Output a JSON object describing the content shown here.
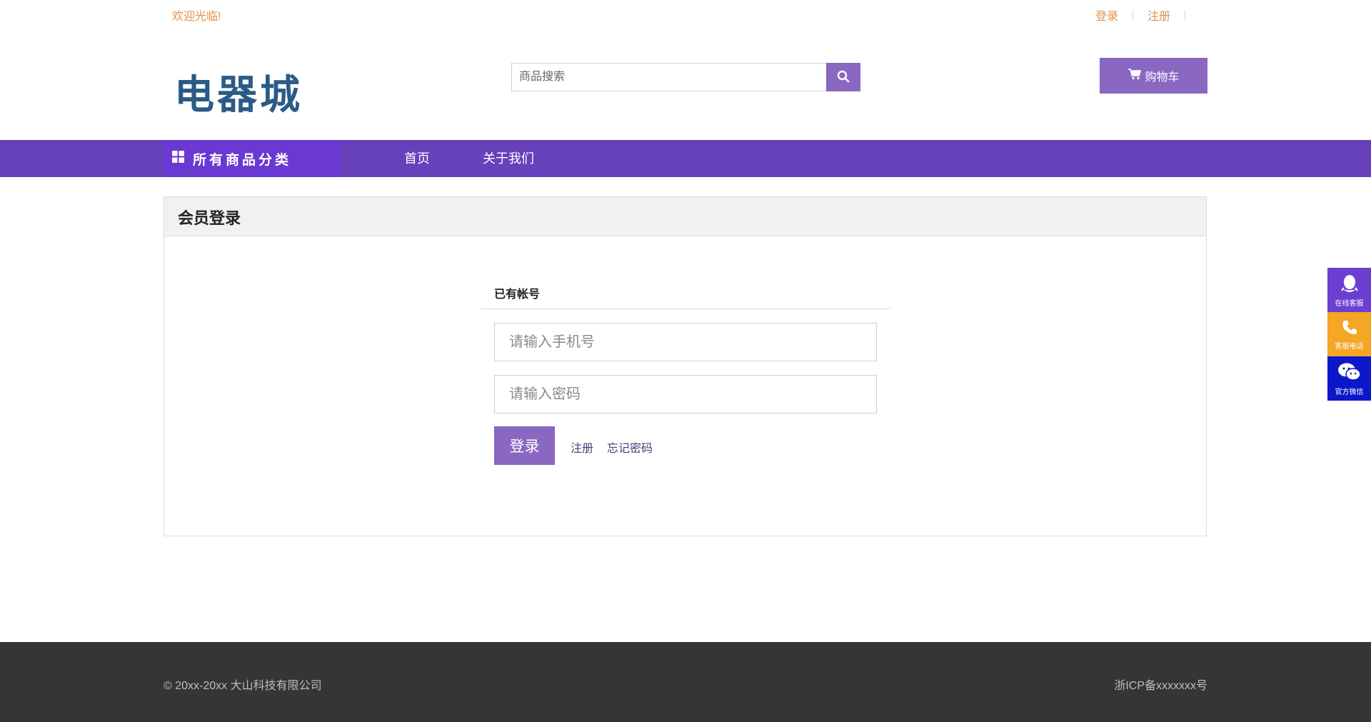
{
  "topbar": {
    "welcome": "欢迎光临!",
    "login": "登录",
    "register": "注册"
  },
  "header": {
    "logo_text": "电器城",
    "search_placeholder": "商品搜索",
    "cart_label": "购物车"
  },
  "nav": {
    "categories_label": "所有商品分类",
    "items": [
      {
        "label": "首页"
      },
      {
        "label": "关于我们"
      }
    ]
  },
  "login_panel": {
    "title": "会员登录",
    "subtitle": "已有帐号",
    "phone_placeholder": "请输入手机号",
    "password_placeholder": "请输入密码",
    "login_button": "登录",
    "register_link": "注册",
    "forgot_link": "忘记密码"
  },
  "side_widgets": [
    {
      "label": "在线客服",
      "icon": "qq-penguin-icon",
      "color": "#6b3fd1"
    },
    {
      "label": "客服电话",
      "icon": "phone-icon",
      "color": "#f5a623"
    },
    {
      "label": "官方微信",
      "icon": "wechat-icon",
      "color": "#0b18c9"
    }
  ],
  "footer": {
    "copyright": "© 20xx-20xx 大山科技有限公司",
    "icp": "浙ICP备xxxxxxx号"
  },
  "colors": {
    "accent": "#8a67c1",
    "nav": "#6740bb",
    "nav_category": "#6a38d2",
    "link_orange": "#e0904a",
    "footer": "#353535"
  }
}
